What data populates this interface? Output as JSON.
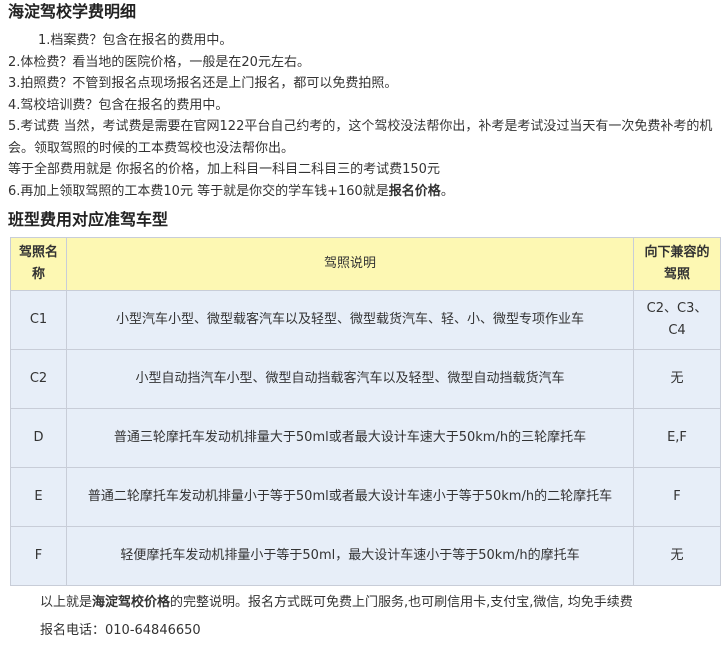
{
  "title": "海淀驾校学费明细",
  "items": [
    "1.档案费？包含在报名的费用中。",
    "2.体检费？看当地的医院价格，一般是在20元左右。",
    "3.拍照费？不管到报名点现场报名还是上门报名，都可以免费拍照。",
    "4.驾校培训费？包含在报名的费用中。",
    "5.考试费 当然，考试费是需要在官网122平台自己约考的，这个驾校没法帮你出，补考是考试没过当天有一次免费补考的机会。领取驾照的时候的工本费驾校也没法帮你出。",
    "等于全部费用就是 你报名的价格，加上科目一科目二科目三的考试费150元",
    "6.再加上领取驾照的工本费10元 等于就是你交的学车钱+160就是",
    "报名价格",
    "。"
  ],
  "section_title": "班型费用对应准驾车型",
  "table": {
    "headers": [
      "驾照名称",
      "驾照说明",
      "向下兼容的驾照"
    ],
    "rows": [
      {
        "code": "C1",
        "desc": "小型汽车小型、微型载客汽车以及轻型、微型载货汽车、轻、小、微型专项作业车",
        "compat": "C2、C3、C4"
      },
      {
        "code": "C2",
        "desc": "小型自动挡汽车小型、微型自动挡载客汽车以及轻型、微型自动挡载货汽车",
        "compat": "无"
      },
      {
        "code": "D",
        "desc": "普通三轮摩托车发动机排量大于50ml或者最大设计车速大于50km/h的三轮摩托车",
        "compat": "E,F"
      },
      {
        "code": "E",
        "desc": "普通二轮摩托车发动机排量小于等于50ml或者最大设计车速小于等于50km/h的二轮摩托车",
        "compat": "F"
      },
      {
        "code": "F",
        "desc": "轻便摩托车发动机排量小于等于50ml，最大设计车速小于等于50km/h的摩托车",
        "compat": "无"
      }
    ]
  },
  "footer": {
    "prefix": "以上就是",
    "bold": "海淀驾校价格",
    "suffix": "的完整说明。报名方式既可免费上门服务,也可刷信用卡,支付宝,微信, 均免手续费",
    "phone": "报名电话：010-64846650"
  }
}
